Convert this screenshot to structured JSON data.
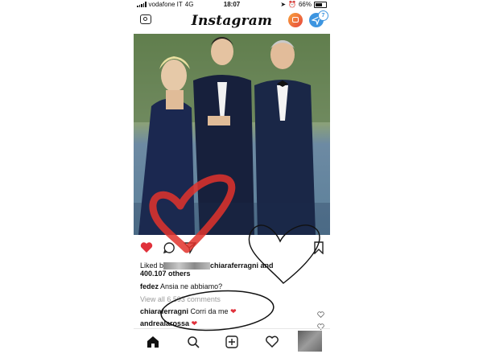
{
  "status_bar": {
    "carrier": "vodafone IT",
    "network": "4G",
    "time": "18:07",
    "battery": "66%"
  },
  "header": {
    "logo": "Instagram",
    "dm_badge": "7",
    "icons": [
      "camera-icon",
      "igtv-icon",
      "direct-message-icon"
    ]
  },
  "post": {
    "liked_prefix": "Liked b",
    "liked_user": "chiaraferragni and",
    "likes_count": "400.107 others",
    "caption_user": "fedez",
    "caption_text": "Ansia ne abbiamo?",
    "view_comments": "View all 6.593 comments",
    "comments": [
      {
        "user": "chiaraferragni",
        "text": "Corri da me"
      },
      {
        "user": "andrealarossa",
        "text": ""
      }
    ],
    "action_icons": [
      "heart-filled-icon",
      "comment-icon",
      "share-icon",
      "bookmark-icon"
    ]
  },
  "bottom_nav": [
    "home-icon",
    "search-icon",
    "add-post-icon",
    "activity-heart-icon",
    "profile-avatar"
  ],
  "colors": {
    "like_red": "#e0313b",
    "annotation_red": "#e2322c",
    "dm_blue": "#3d95e0",
    "suit_navy": "#1a2747"
  }
}
